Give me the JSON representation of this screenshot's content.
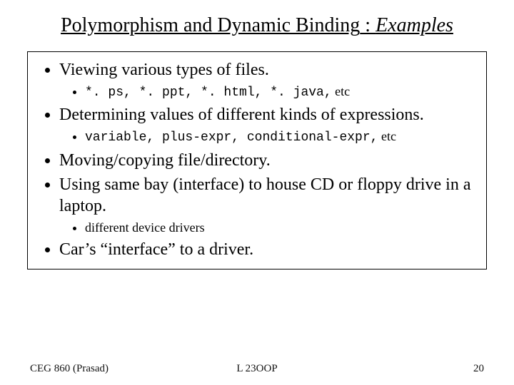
{
  "title": {
    "part1": "Polymorphism  and  Dynamic Binding",
    "sep": " : ",
    "part2": "Examples"
  },
  "bullets": [
    {
      "text": "Viewing various types of files.",
      "sub": [
        {
          "mono": "*. ps, *. ppt, *. html, *. java,",
          "after": " etc"
        }
      ]
    },
    {
      "text": "Determining values of different kinds of expressions.",
      "sub": [
        {
          "mono": "variable, plus-expr, conditional-expr,",
          "after": " etc"
        }
      ]
    },
    {
      "text": "Moving/copying   file/directory."
    },
    {
      "text": "Using same bay (interface) to house CD or floppy drive in a laptop.",
      "sub": [
        {
          "plain": "different device drivers"
        }
      ]
    },
    {
      "text": "Car’s “interface” to a driver."
    }
  ],
  "footer": {
    "left": "CEG 860  (Prasad)",
    "center": "L 23OOP",
    "right": "20"
  }
}
